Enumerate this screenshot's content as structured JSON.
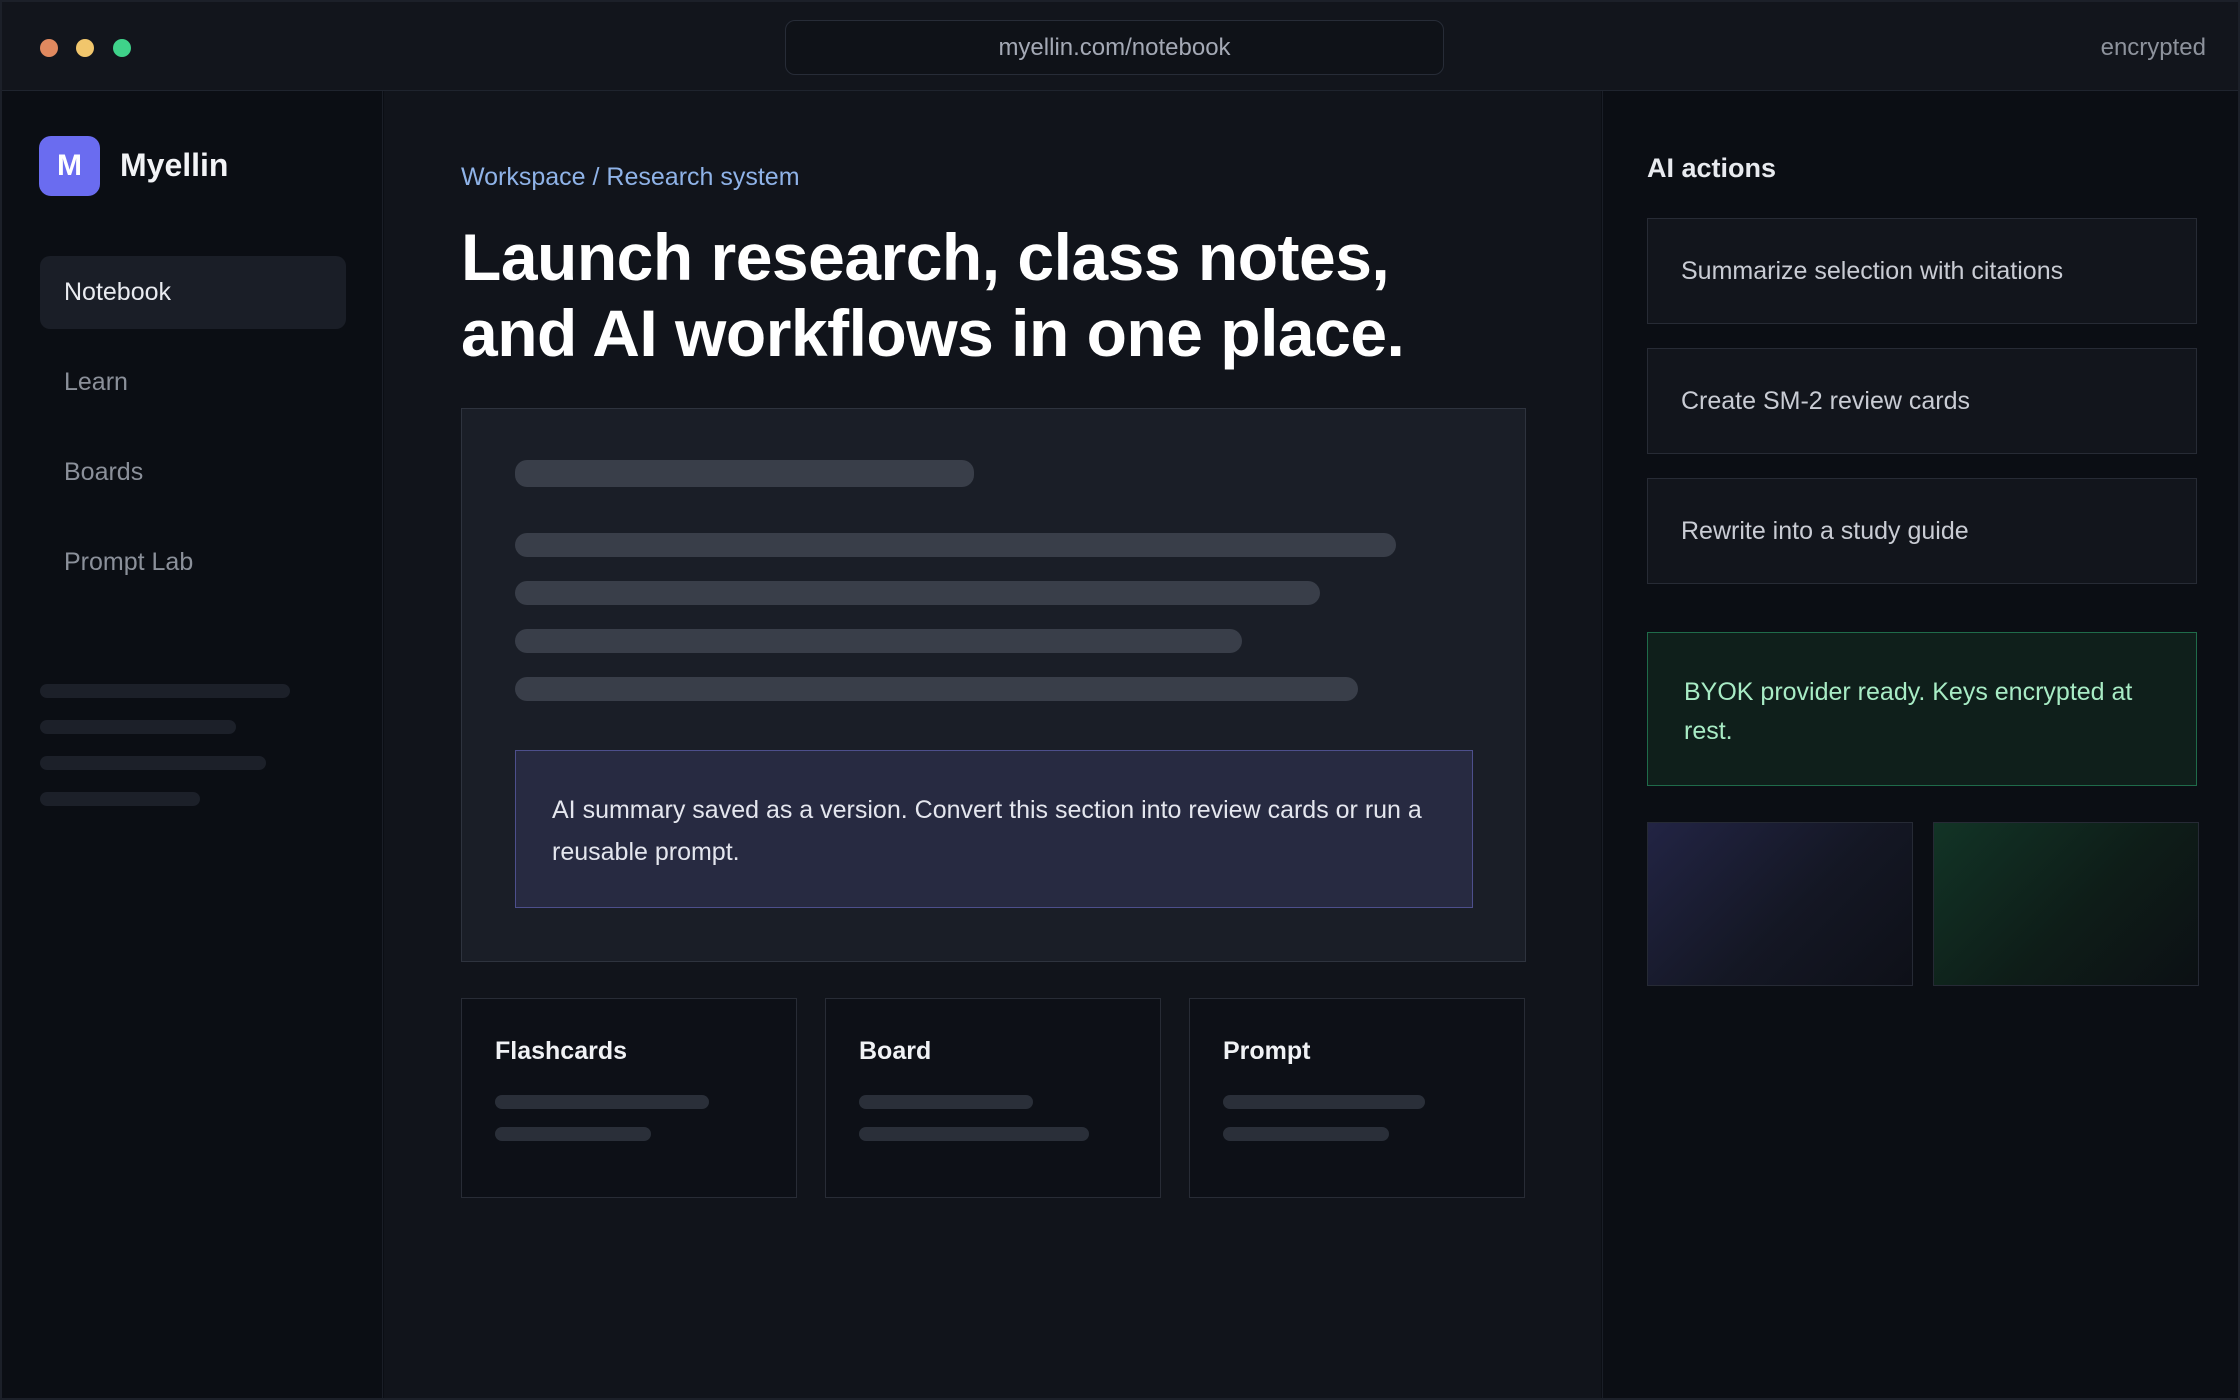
{
  "window": {
    "url": "myellin.com/notebook",
    "status": "encrypted"
  },
  "sidebar": {
    "logo_letter": "M",
    "brand": "Myellin",
    "items": [
      {
        "label": "Notebook",
        "active": true
      },
      {
        "label": "Learn",
        "active": false
      },
      {
        "label": "Boards",
        "active": false
      },
      {
        "label": "Prompt Lab",
        "active": false
      }
    ]
  },
  "main": {
    "breadcrumb": "Workspace / Research system",
    "headline": "Launch research, class notes, and AI workflows in one place.",
    "callout": "AI summary saved as a version. Convert this section into review cards or run a reusable prompt.",
    "cards": [
      {
        "title": "Flashcards"
      },
      {
        "title": "Board"
      },
      {
        "title": "Prompt"
      }
    ]
  },
  "right_panel": {
    "title": "AI actions",
    "actions": [
      {
        "label": "Summarize selection with citations"
      },
      {
        "label": "Create SM-2 review cards"
      },
      {
        "label": "Rewrite into a study guide"
      }
    ],
    "notice": "BYOK provider ready. Keys encrypted at rest."
  },
  "colors": {
    "accent": "#6a6cf0",
    "background": "#0b0e14",
    "success_text": "#a8ecc5",
    "link": "#8fb3e8"
  }
}
